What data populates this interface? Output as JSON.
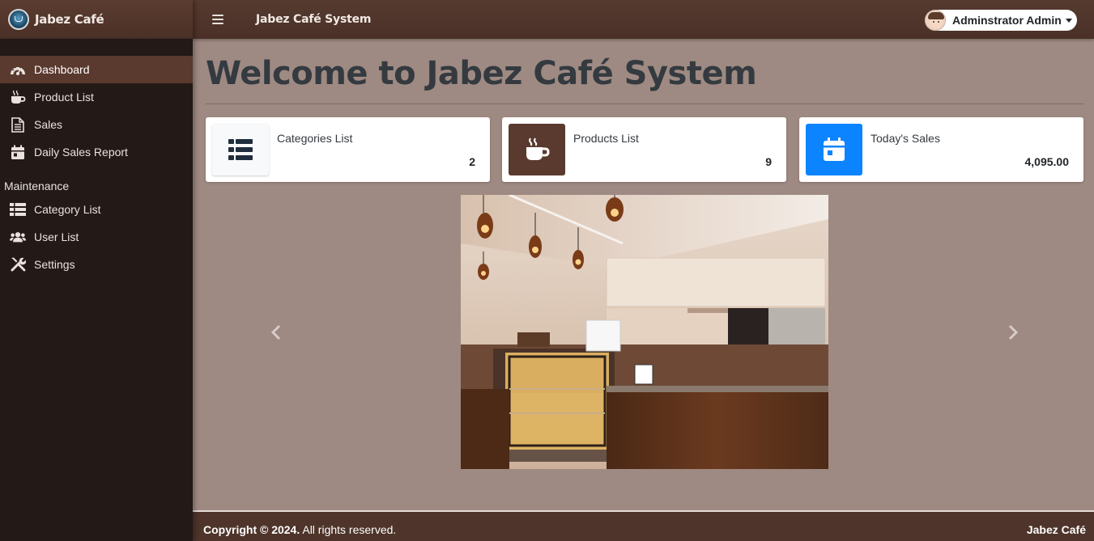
{
  "brand": {
    "name": "Jabez Café"
  },
  "topbar": {
    "title": "Jabez Café System",
    "user_name": "Adminstrator Admin"
  },
  "sidebar": {
    "items": [
      {
        "label": "Dashboard",
        "icon": "dashboard-gauge-icon",
        "active": true
      },
      {
        "label": "Product List",
        "icon": "coffee-cup-icon"
      },
      {
        "label": "Sales",
        "icon": "document-icon"
      },
      {
        "label": "Daily Sales Report",
        "icon": "calendar-icon"
      }
    ],
    "section_header": "Maintenance",
    "maintenance_items": [
      {
        "label": "Category List",
        "icon": "table-list-icon"
      },
      {
        "label": "User List",
        "icon": "users-icon"
      },
      {
        "label": "Settings",
        "icon": "tools-icon"
      }
    ]
  },
  "main": {
    "page_title": "Welcome to Jabez Café System",
    "cards": [
      {
        "label": "Categories List",
        "value": "2",
        "icon": "list-icon",
        "icon_bg": "#f8f9fa"
      },
      {
        "label": "Products List",
        "value": "9",
        "icon": "coffee-cup-icon",
        "icon_bg": "#5a3a2e"
      },
      {
        "label": "Today's Sales",
        "value": "4,095.00",
        "icon": "calendar-icon",
        "icon_bg": "#0d84ff"
      }
    ]
  },
  "footer": {
    "copyright_bold": "Copyright © 2024.",
    "copyright_rest": " All rights reserved.",
    "brand": "Jabez Café"
  },
  "colors": {
    "sidebar_bg": "#231a17",
    "topbar_bg": "#4e342a",
    "content_bg": "#9e8a82",
    "active_nav": "#5a3a2e",
    "accent_blue": "#0d84ff"
  }
}
